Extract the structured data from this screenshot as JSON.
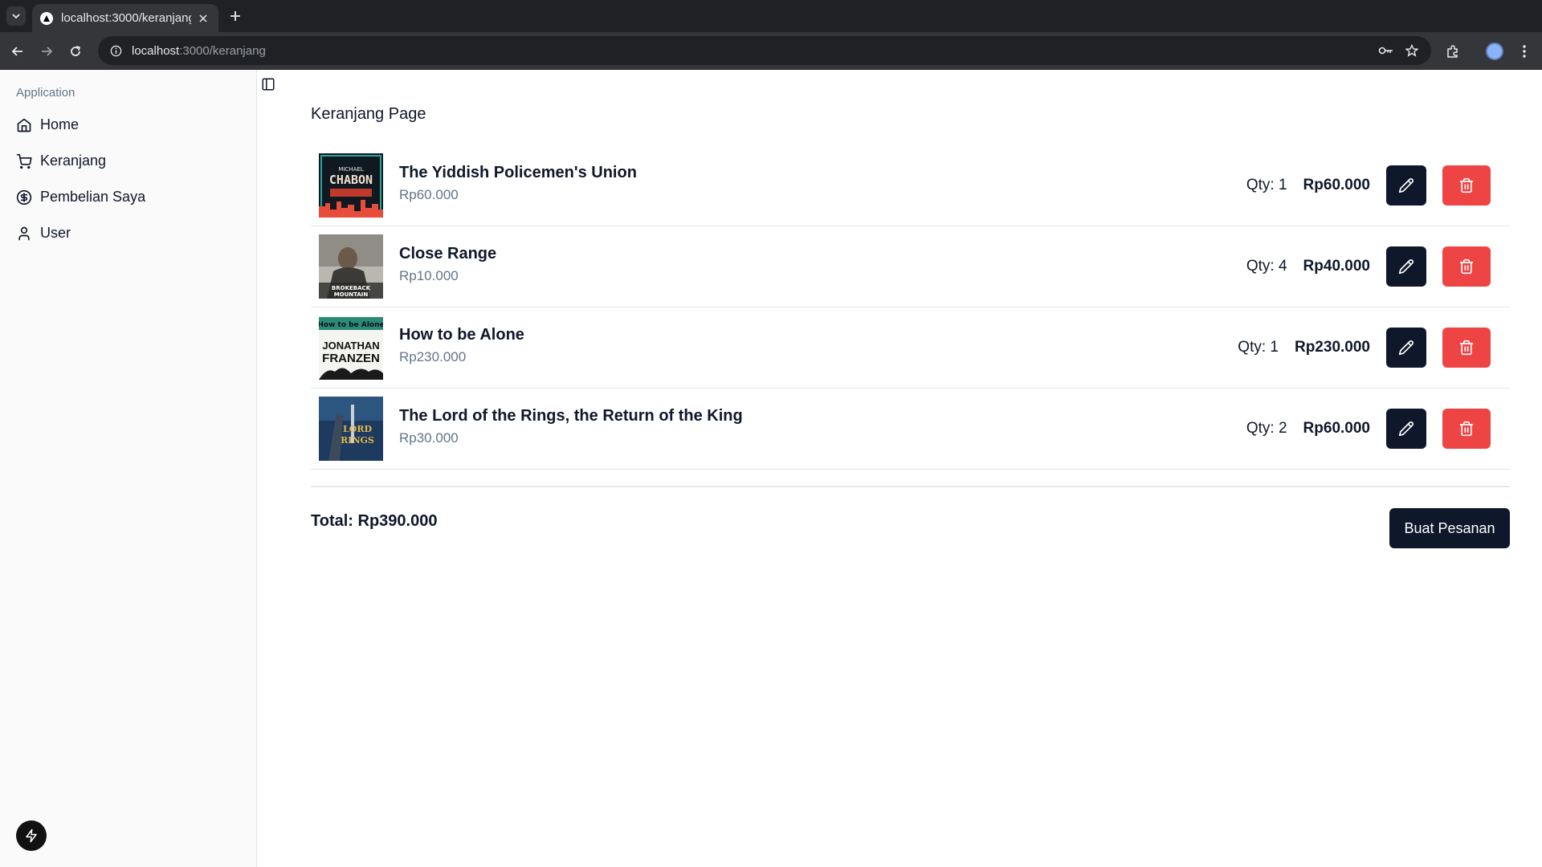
{
  "browser": {
    "tab_title": "localhost:3000/keranjang",
    "url_host": "localhost",
    "url_path": ":3000/keranjang"
  },
  "sidebar": {
    "group_label": "Application",
    "items": [
      {
        "label": "Home",
        "icon": "home-icon"
      },
      {
        "label": "Keranjang",
        "icon": "cart-icon"
      },
      {
        "label": "Pembelian Saya",
        "icon": "dollar-circle-icon"
      },
      {
        "label": "User",
        "icon": "user-icon"
      }
    ]
  },
  "main": {
    "title": "Keranjang Page",
    "cart_items": [
      {
        "title": "The Yiddish Policemen's Union",
        "price": "Rp60.000",
        "qty": "Qty: 1",
        "subtotal": "Rp60.000",
        "cover_text": [
          "MICHAEL",
          "CHABON"
        ]
      },
      {
        "title": "Close Range",
        "price": "Rp10.000",
        "qty": "Qty: 4",
        "subtotal": "Rp40.000",
        "cover_text": [
          "BROKEBACK",
          "MOUNTAIN"
        ]
      },
      {
        "title": "How to be Alone",
        "price": "Rp230.000",
        "qty": "Qty: 1",
        "subtotal": "Rp230.000",
        "cover_text": [
          "How to be Alone",
          "JONATHAN",
          "FRANZEN"
        ]
      },
      {
        "title": "The Lord of the Rings, the Return of the King",
        "price": "Rp30.000",
        "qty": "Qty: 2",
        "subtotal": "Rp60.000",
        "cover_text": [
          "LORD",
          "RINGS"
        ]
      }
    ],
    "total": "Total: Rp390.000",
    "checkout_label": "Buat Pesanan"
  },
  "colors": {
    "primary": "#0f172a",
    "danger": "#ef4444",
    "muted": "#64748b"
  }
}
